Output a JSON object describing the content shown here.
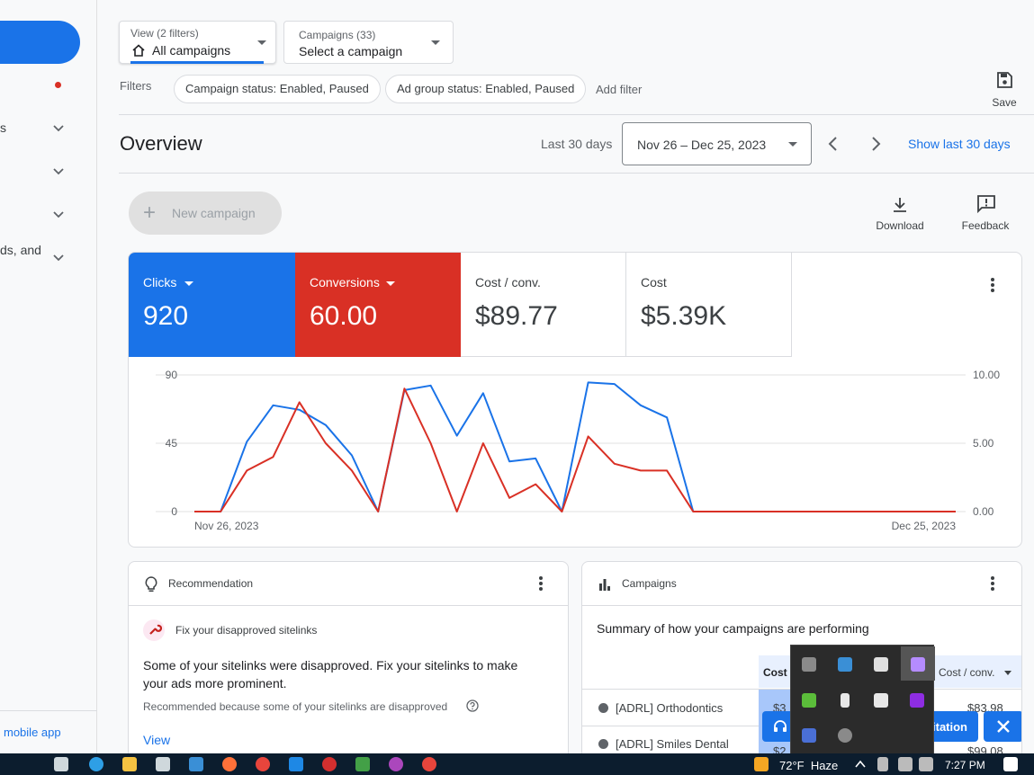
{
  "sidebar": {
    "items": [
      {
        "label": "s"
      },
      {
        "label": ""
      },
      {
        "label": ""
      },
      {
        "label": "ds, and"
      }
    ],
    "mobile_app": "mobile app"
  },
  "toolbar": {
    "view_label": "View (2 filters)",
    "view_value": "All campaigns",
    "campaigns_label": "Campaigns (33)",
    "campaigns_value": "Select a campaign",
    "save_label": "Save"
  },
  "filters": {
    "label": "Filters",
    "chips": [
      "Campaign status: Enabled, Paused",
      "Ad group status: Enabled, Paused"
    ],
    "add_filter": "Add filter"
  },
  "overview": {
    "title": "Overview",
    "range_label": "Last 30 days",
    "date_range": "Nov 26 – Dec 25, 2023",
    "show_last": "Show last 30 days",
    "new_campaign": "New campaign",
    "download": "Download",
    "feedback": "Feedback"
  },
  "metrics": [
    {
      "label": "Clicks",
      "value": "920",
      "color": "#1a73e8"
    },
    {
      "label": "Conversions",
      "value": "60.00",
      "color": "#d93025"
    },
    {
      "label": "Cost / conv.",
      "value": "$89.77"
    },
    {
      "label": "Cost",
      "value": "$5.39K"
    }
  ],
  "chart_data": {
    "type": "line",
    "x_start_label": "Nov 26, 2023",
    "x_end_label": "Dec 25, 2023",
    "y_left_ticks": [
      "90",
      "45",
      "0"
    ],
    "y_right_ticks": [
      "10.00",
      "5.00",
      "0.00"
    ],
    "ylim_left": [
      0,
      90
    ],
    "ylim_right": [
      0,
      10
    ],
    "grid": true,
    "series": [
      {
        "name": "Clicks",
        "axis": "left",
        "color": "#1a73e8",
        "values": [
          0,
          0,
          46,
          70,
          67,
          57,
          37,
          0,
          80,
          83,
          50,
          78,
          33,
          35,
          0,
          85,
          84,
          70,
          62,
          0,
          0,
          0,
          0,
          0,
          0,
          0,
          0,
          0,
          0,
          0
        ]
      },
      {
        "name": "Conversions",
        "axis": "right",
        "color": "#d93025",
        "values": [
          0,
          0,
          3,
          4,
          8,
          5,
          3,
          0,
          9,
          5,
          0,
          5,
          1,
          2,
          0,
          5.5,
          3.5,
          3,
          3,
          0,
          0,
          0,
          0,
          0,
          0,
          0,
          0,
          0,
          0,
          0
        ]
      }
    ]
  },
  "recommendation": {
    "header": "Recommendation",
    "item_title": "Fix your disapproved sitelinks",
    "body": "Some of your sitelinks were disapproved. Fix your sitelinks to make your ads more prominent.",
    "reason": "Recommended because some of your sitelinks are disapproved",
    "view": "View"
  },
  "campaigns_card": {
    "header": "Campaigns",
    "summary": "Summary of how your campaigns are performing",
    "col_cost": "Cost",
    "col_cost_conv": "Cost / conv.",
    "rows": [
      {
        "name": "[ADRL] Orthodontics",
        "cost_partial": "$3",
        "cost_conv": "$83.98"
      },
      {
        "name": "[ADRL] Smiles Dental",
        "cost_partial": "$2",
        "cost_conv": "$99.08"
      }
    ],
    "banner_text": "itation"
  },
  "taskbar": {
    "weather": "72°F  Haze",
    "time": "7:27 PM"
  }
}
